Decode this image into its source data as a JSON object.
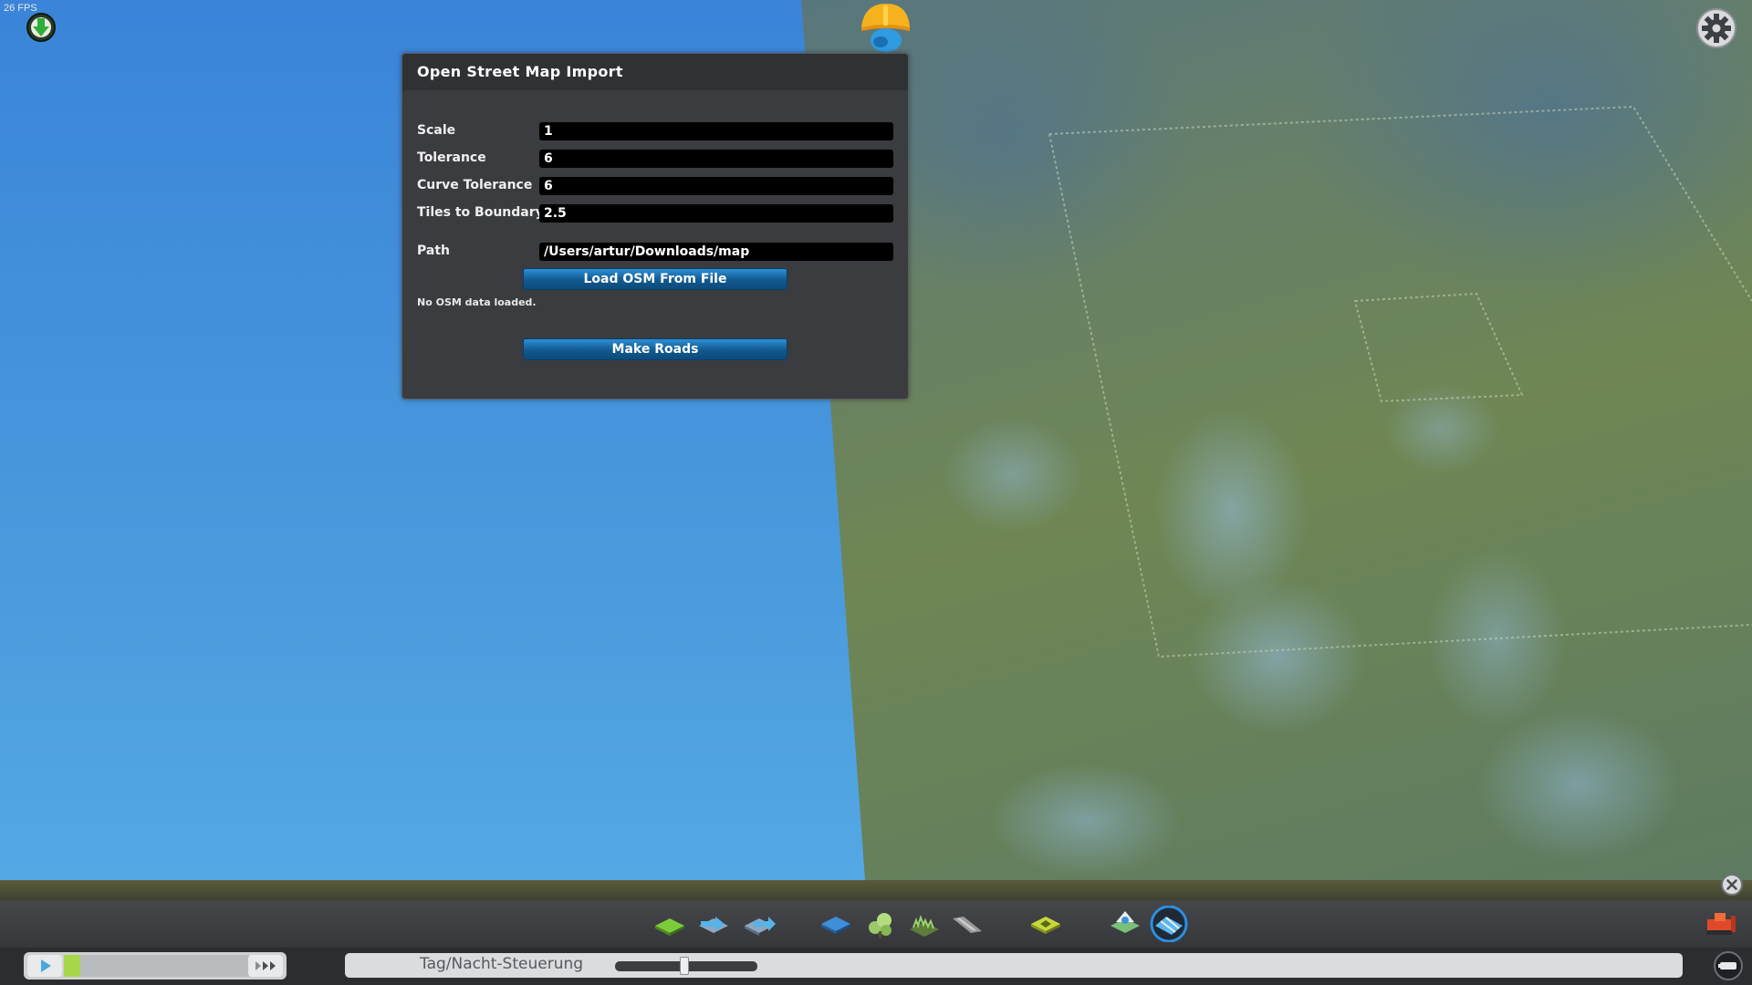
{
  "hud": {
    "fps": "26 FPS"
  },
  "dialog": {
    "title": "Open Street Map Import",
    "fields": [
      {
        "label": "Scale",
        "value": "1"
      },
      {
        "label": "Tolerance",
        "value": "6"
      },
      {
        "label": "Curve Tolerance",
        "value": "6"
      },
      {
        "label": "Tiles to Boundary",
        "value": "2.5"
      }
    ],
    "path": {
      "label": "Path",
      "value": "/Users/artur/Downloads/map"
    },
    "load_button": "Load OSM From File",
    "status": "No OSM data loaded.",
    "make_roads_button": "Make Roads"
  },
  "toolbar": {
    "tools": [
      {
        "name": "terrain-shift-icon",
        "color": "#7ccc3a"
      },
      {
        "name": "terrain-level-icon",
        "color": "#55b4e8"
      },
      {
        "name": "terrain-soften-icon",
        "color": "#8fa6c0"
      },
      {
        "name": "water-icon",
        "color": "#3e8fd8"
      },
      {
        "name": "trees-icon",
        "color": "#9bc86a"
      },
      {
        "name": "resources-icon",
        "color": "#5f7d3a"
      },
      {
        "name": "roads-icon",
        "color": "#9a9a9a"
      },
      {
        "name": "landscaping-icon",
        "color": "#c8d83a"
      },
      {
        "name": "area-tiles-icon",
        "color": "#7ac07a"
      },
      {
        "name": "osm-import-icon",
        "color": "#2a8fe0"
      }
    ]
  },
  "bottom_bar": {
    "daynight_label": "Tag/Nacht-Steuerung"
  }
}
